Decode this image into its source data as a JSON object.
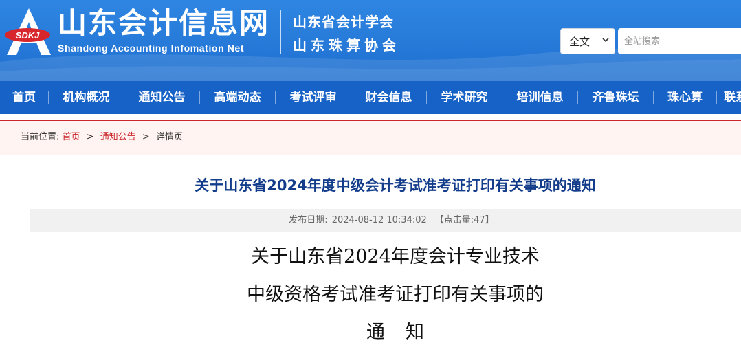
{
  "header": {
    "logo_badge": "SDKJ",
    "site_title": "山东会计信息网",
    "site_subtitle": "Shandong Accounting Infomation Net",
    "org_primary": "山东省会计学会",
    "org_secondary": "山东珠算协会",
    "colors": {
      "header_blue": "#2f86e2",
      "nav_blue": "#1762c6",
      "accent_red": "#c9272d"
    }
  },
  "search": {
    "scope_selected": "全文",
    "placeholder": "全站搜索",
    "value": ""
  },
  "nav": {
    "items": [
      {
        "label": "首页"
      },
      {
        "label": "机构概况"
      },
      {
        "label": "通知公告"
      },
      {
        "label": "高端动态"
      },
      {
        "label": "考试评审"
      },
      {
        "label": "财会信息"
      },
      {
        "label": "学术研究"
      },
      {
        "label": "培训信息"
      },
      {
        "label": "齐鲁珠坛"
      },
      {
        "label": "珠心算"
      },
      {
        "label": "联系我们"
      }
    ]
  },
  "breadcrumb": {
    "prefix": "当前位置:",
    "items": [
      "首页",
      "通知公告",
      "详情页"
    ],
    "separator": ">"
  },
  "article": {
    "title": "关于山东省2024年度中级会计考试准考证打印有关事项的通知",
    "publish_label": "发布日期:",
    "publish_date": "2024-08-12 10:34:02",
    "hits_text": "【点击量:47】",
    "body_lines": [
      "关于山东省2024年度会计专业技术",
      "中级资格考试准考证打印有关事项的",
      "通知"
    ]
  }
}
